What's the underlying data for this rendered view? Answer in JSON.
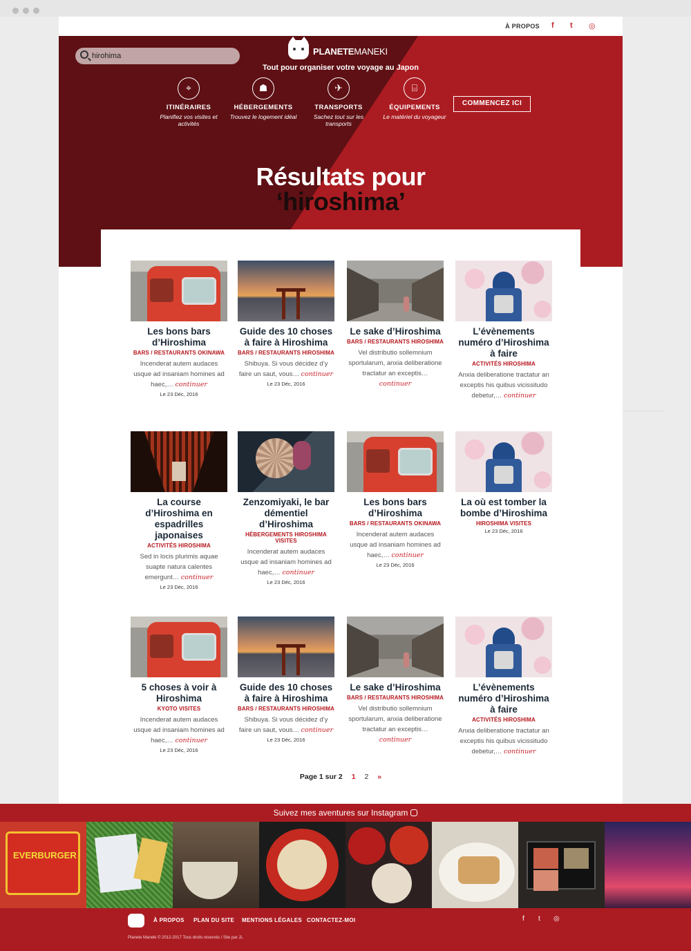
{
  "topbar": {
    "about": "À PROPOS",
    "social": [
      {
        "icon": "facebook-icon",
        "glyph": "f"
      },
      {
        "icon": "twitter-icon",
        "glyph": "t"
      },
      {
        "icon": "instagram-icon",
        "glyph": "◎"
      }
    ]
  },
  "header": {
    "search_value": "hirohima",
    "brand_bold": "PLANETE",
    "brand_light": "MANEKI",
    "tagline": "Tout pour organiser votre voyage au Japon",
    "nav": [
      {
        "title": "ITINÉRAIRES",
        "sub": "Planifiez vos visites et activités",
        "icon": "japan-map-icon",
        "glyph": "⌖"
      },
      {
        "title": "HÉBERGEMENTS",
        "sub": "Trouvez le logement idéal",
        "icon": "reception-bell-icon",
        "glyph": "☗"
      },
      {
        "title": "TRANSPORTS",
        "sub": "Sachez tout sur les transports",
        "icon": "plane-icon",
        "glyph": "✈"
      },
      {
        "title": "ÉQUIPEMENTS",
        "sub": "Le matériel du voyageur",
        "icon": "camera-icon",
        "glyph": "⌸"
      }
    ],
    "cta": "COMMENCEZ ICI"
  },
  "results": {
    "title_line1": "Résultats pour",
    "title_query": "‘hiroshima’"
  },
  "more_label": "continuer",
  "posts": [
    {
      "thumb": "train",
      "title": "Les bons bars d’Hiroshima",
      "category": "BARS / RESTAURANTS OKINAWA",
      "excerpt": "Incenderat autem audaces usque ad insaniam homines ad haec,…",
      "date": "Le 23 Déc, 2016"
    },
    {
      "thumb": "sunset",
      "title": "Guide des 10 choses à faire à Hiroshima",
      "category": "BARS / RESTAURANTS HIROSHIMA",
      "excerpt": "Shibuya. Si vous décidez d’y faire un saut, vous…",
      "date": "Le 23 Déc, 2016"
    },
    {
      "thumb": "street",
      "title": "Le sake d’Hiroshima",
      "category": "BARS / RESTAURANTS HIROSHIMA",
      "excerpt": "Vel distributio sollemnium sportularum, anxia deliberatione tractatur an exceptis…",
      "date": ""
    },
    {
      "thumb": "kid",
      "title": "L’évènements numéro d’Hiroshima à faire",
      "category": "ACTIVITÉS HIROSHIMA",
      "excerpt": "Anxia deliberatione tractatur an exceptis his quibus vicissitudo debetur,…",
      "date": ""
    },
    {
      "thumb": "torii",
      "title": "La course d’Hiroshima en espadrilles japonaises",
      "category": "ACTIVITÉS HIROSHIMA",
      "excerpt": "Sed in locis plurimis aquae suapte natura calentes emergunt…",
      "date": "Le 23 Déc, 2016"
    },
    {
      "thumb": "umbrella",
      "title": "Zenzomiyaki, le bar démentiel d’Hiroshima",
      "category": "HÉBERGEMENTS HIROSHIMA VISITES",
      "excerpt": "Incenderat autem audaces usque ad insaniam homines ad haec,…",
      "date": "Le 23 Déc, 2016"
    },
    {
      "thumb": "train",
      "title": "Les bons bars d’Hiroshima",
      "category": "BARS / RESTAURANTS OKINAWA",
      "excerpt": "Incenderat autem audaces usque ad insaniam homines ad haec,…",
      "date": "Le 23 Déc, 2016"
    },
    {
      "thumb": "kid",
      "title": "La où est tomber la bombe d’Hiroshima",
      "category": "HIROSHIMA VISITES",
      "excerpt": "",
      "date": "Le 23 Déc, 2016"
    },
    {
      "thumb": "train",
      "title": "5 choses à voir à Hiroshima",
      "category": "KYOTO VISITES",
      "excerpt": "Incenderat autem audaces usque ad insaniam homines ad haec,…",
      "date": "Le 23 Déc, 2016"
    },
    {
      "thumb": "sunset",
      "title": "Guide des 10 choses à faire à Hiroshima",
      "category": "BARS / RESTAURANTS HIROSHIMA",
      "excerpt": "Shibuya. Si vous décidez d’y faire un saut, vous…",
      "date": "Le 23 Déc, 2016"
    },
    {
      "thumb": "street",
      "title": "Le sake d’Hiroshima",
      "category": "BARS / RESTAURANTS HIROSHIMA",
      "excerpt": "Vel distributio sollemnium sportularum, anxia deliberatione tractatur an exceptis…",
      "date": ""
    },
    {
      "thumb": "kid",
      "title": "L’évènements numéro d’Hiroshima à faire",
      "category": "ACTIVITÉS HIROSHIMA",
      "excerpt": "Anxia deliberatione tractatur an exceptis his quibus vicissitudo debetur,…",
      "date": ""
    }
  ],
  "pagination": {
    "label": "Page 1 sur 2",
    "current": "1",
    "next_page": "2",
    "next": "»"
  },
  "instagram": {
    "label": "Suivez mes aventures sur Instagram"
  },
  "footer": {
    "links": [
      "À PROPOS",
      "PLAN DU SITE",
      "MENTIONS LÉGALES",
      "CONTACTEZ-MOI"
    ],
    "social": [
      "f",
      "t",
      "◎"
    ],
    "copyright": "Planete Maneki © 2012-2017 Tous droits réservés / Site par JL"
  },
  "colors": {
    "brand_red": "#ab1c22",
    "dark_red": "#5e1014",
    "accent": "#c9252c",
    "title_text": "#1b2835"
  }
}
